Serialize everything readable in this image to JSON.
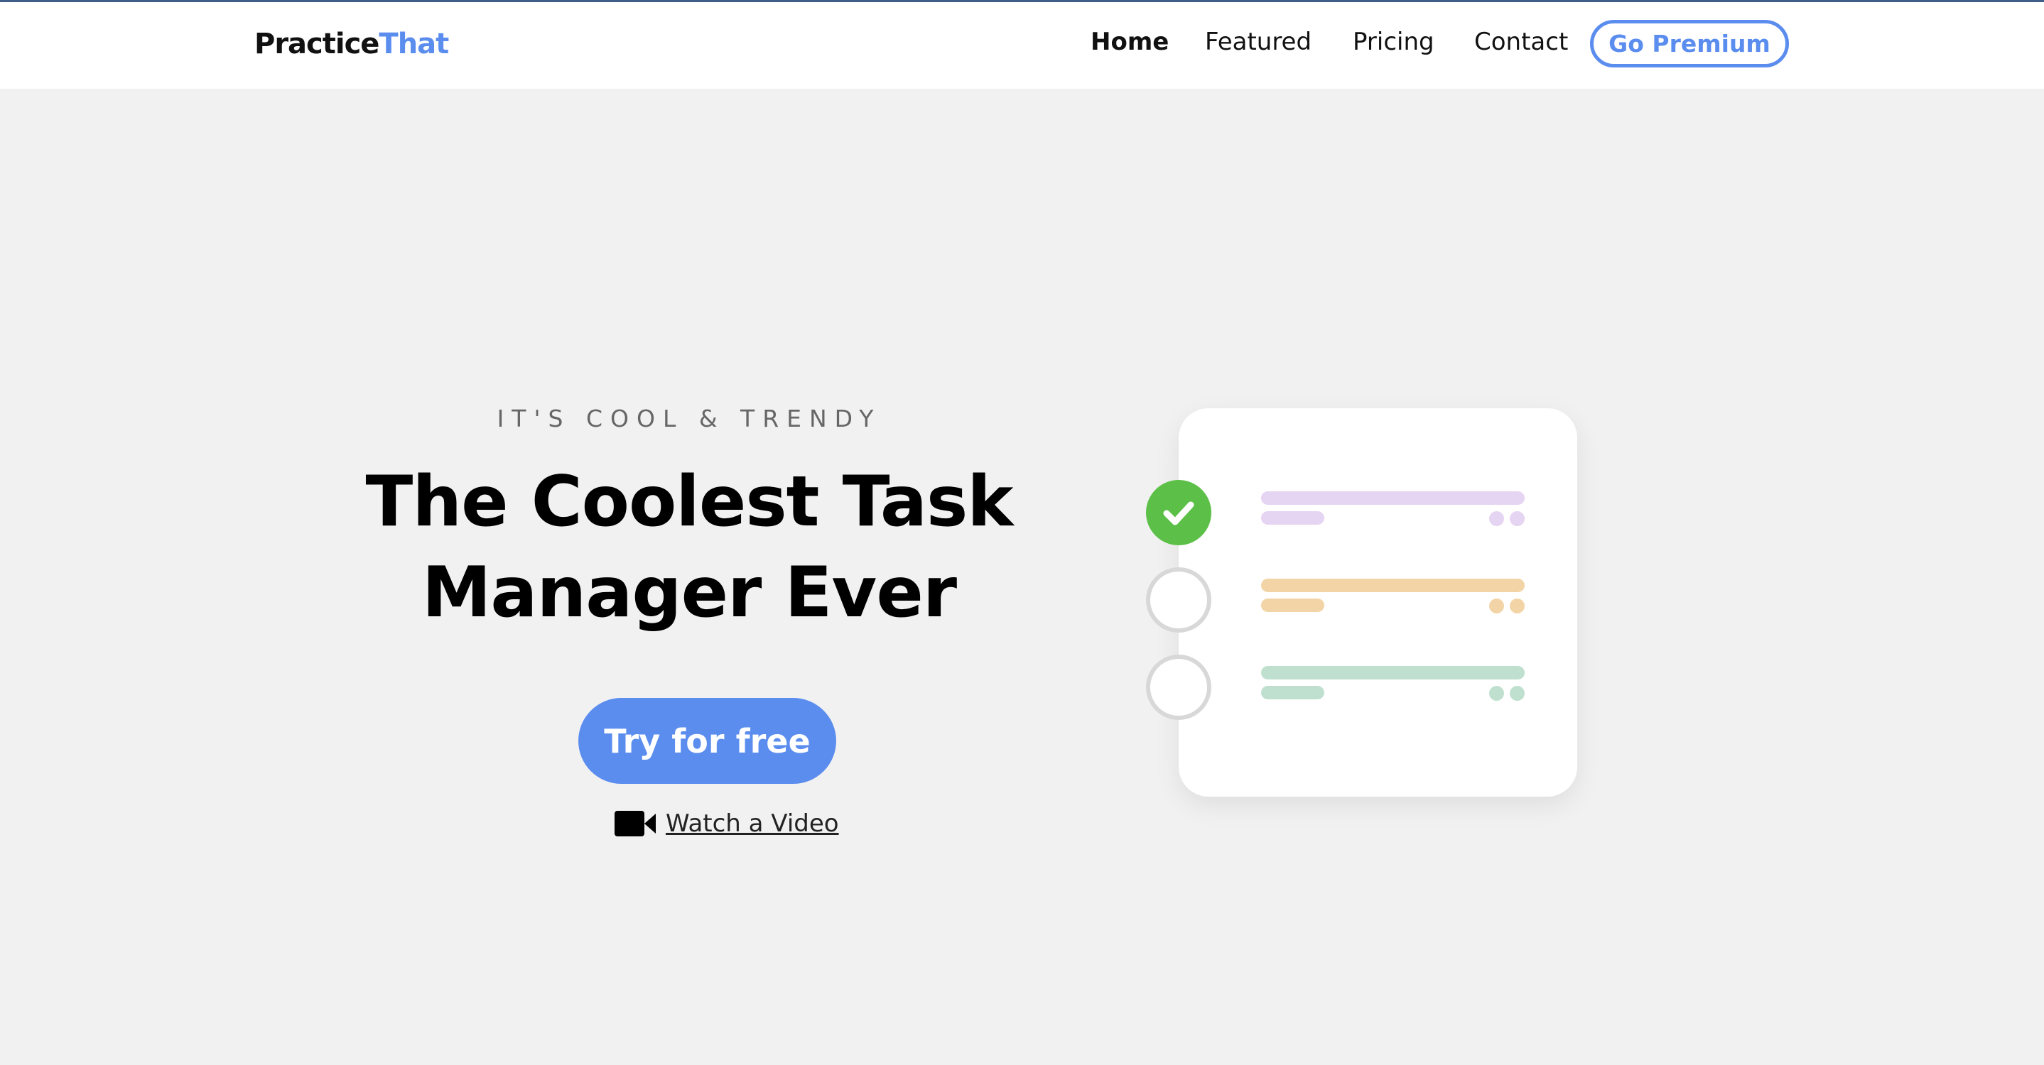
{
  "nav": {
    "logo_main": "Practice",
    "logo_accent": "That",
    "items": [
      {
        "label": "Home",
        "active": true
      },
      {
        "label": "Featured",
        "active": false
      },
      {
        "label": "Pricing",
        "active": false
      },
      {
        "label": "Contact",
        "active": false
      }
    ],
    "cta_label": "Go Premium"
  },
  "hero": {
    "eyebrow": "IT'S COOL & TRENDY",
    "headline_line1": "The Coolest Task",
    "headline_line2": "Manager Ever",
    "cta_label": "Try for free",
    "video_link": "Watch a Video",
    "video_icon": "video-camera-icon"
  },
  "illustration": {
    "tasks": [
      {
        "status": "done",
        "color": "#e5d4f2"
      },
      {
        "status": "todo",
        "color": "#f2d4a6"
      },
      {
        "status": "todo",
        "color": "#bfe0cf"
      }
    ]
  },
  "colors": {
    "accent": "#5b8def",
    "background": "#f1f1f1",
    "check_done": "#5cc048"
  }
}
